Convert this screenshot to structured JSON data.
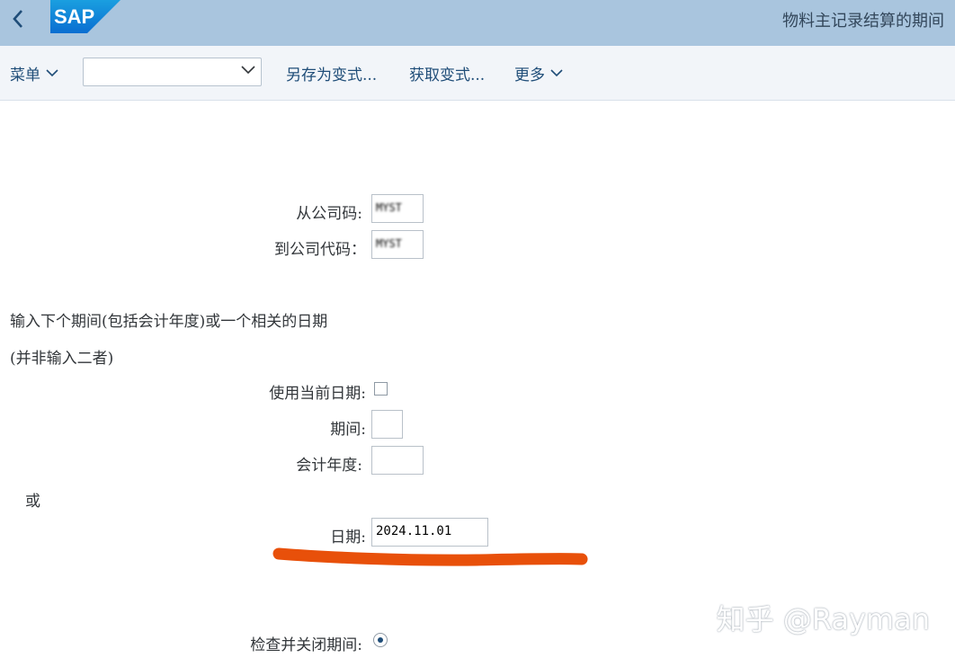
{
  "shell": {
    "logo_text": "SAP",
    "app_title": "物料主记录结算的期间",
    "brand_color": "#0a6ed1",
    "back_icon": "chevron-left-icon"
  },
  "toolbar": {
    "menu_label": "菜单",
    "variant_value": "",
    "save_variant_label": "另存为变式...",
    "get_variant_label": "获取变式...",
    "more_label": "更多"
  },
  "form": {
    "from_company_label": "从公司码:",
    "from_company_value": "MYST",
    "to_company_label": "到公司代码：",
    "to_company_value": "MYST",
    "instruction_line1": "输入下个期间(包括会计年度)或一个相关的日期",
    "instruction_line2": "(并非输入二者)",
    "use_current_date_label": "使用当前日期:",
    "use_current_date_checked": false,
    "period_label": "期间:",
    "period_value": "",
    "fiscal_year_label": "会计年度:",
    "fiscal_year_value": "",
    "or_label": "或",
    "date_label": "日期:",
    "date_value": "2024.11.01",
    "check_close_label": "检查并关闭期间:",
    "check_close_selected": true
  },
  "annotation": {
    "color": "#e8500a"
  },
  "watermark": "知乎 @Rayman"
}
